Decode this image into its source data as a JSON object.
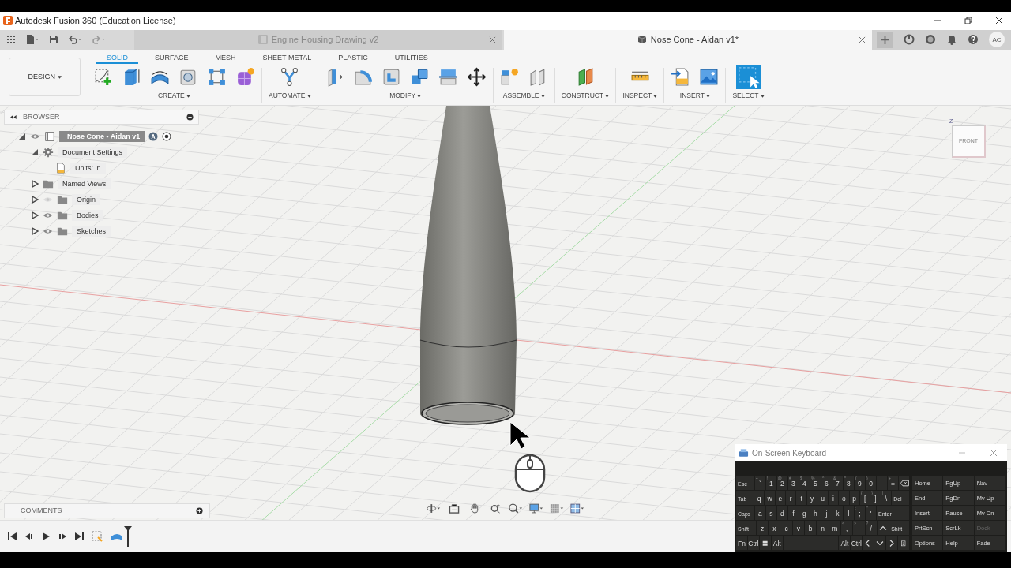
{
  "window": {
    "title": "Autodesk Fusion 360 (Education License)"
  },
  "document_tabs": [
    {
      "label": "Engine Housing Drawing v2",
      "selected": false
    },
    {
      "label": "Nose Cone - Aidan v1*",
      "selected": true
    }
  ],
  "user": {
    "initials": "AC"
  },
  "workspace": {
    "label": "DESIGN"
  },
  "toolbar_tabs": [
    {
      "label": "SOLID",
      "selected": true
    },
    {
      "label": "SURFACE",
      "selected": false
    },
    {
      "label": "MESH",
      "selected": false
    },
    {
      "label": "SHEET METAL",
      "selected": false
    },
    {
      "label": "PLASTIC",
      "selected": false
    },
    {
      "label": "UTILITIES",
      "selected": false
    }
  ],
  "tool_groups": [
    {
      "label": "CREATE"
    },
    {
      "label": "AUTOMATE"
    },
    {
      "label": "MODIFY"
    },
    {
      "label": "ASSEMBLE"
    },
    {
      "label": "CONSTRUCT"
    },
    {
      "label": "INSPECT"
    },
    {
      "label": "INSERT"
    },
    {
      "label": "SELECT"
    }
  ],
  "browser": {
    "title": "BROWSER",
    "tree": [
      {
        "label": "Nose Cone - Aidan v1",
        "kind": "component",
        "expanded": true,
        "visible": true,
        "selected": true,
        "children": [
          {
            "label": "Document Settings",
            "kind": "settings",
            "expanded": true,
            "selected": false,
            "children": [
              {
                "label": "Units: in",
                "kind": "units",
                "selected": false
              }
            ]
          },
          {
            "label": "Named Views",
            "kind": "folder",
            "expanded": false,
            "selected": false
          },
          {
            "label": "Origin",
            "kind": "folder",
            "expanded": false,
            "visible": false,
            "selected": false
          },
          {
            "label": "Bodies",
            "kind": "folder",
            "expanded": false,
            "visible": true,
            "selected": false
          },
          {
            "label": "Sketches",
            "kind": "folder",
            "expanded": false,
            "visible": true,
            "selected": false
          }
        ]
      }
    ]
  },
  "view_cube": {
    "face": "FRONT",
    "axis": "Z"
  },
  "comments": {
    "title": "COMMENTS"
  },
  "on_screen_keyboard": {
    "title": "On-Screen Keyboard",
    "main_rows": [
      [
        {
          "label": "Esc",
          "kind": "mod"
        },
        {
          "label": "`",
          "upper": "~",
          "kind": "char"
        },
        {
          "label": "1",
          "upper": "!",
          "kind": "char"
        },
        {
          "label": "2",
          "upper": "@",
          "kind": "char"
        },
        {
          "label": "3",
          "upper": "#",
          "kind": "char"
        },
        {
          "label": "4",
          "upper": "$",
          "kind": "char"
        },
        {
          "label": "5",
          "upper": "%",
          "kind": "char"
        },
        {
          "label": "6",
          "upper": "^",
          "kind": "char"
        },
        {
          "label": "7",
          "upper": "&",
          "kind": "char"
        },
        {
          "label": "8",
          "upper": "*",
          "kind": "char"
        },
        {
          "label": "9",
          "upper": "(",
          "kind": "char"
        },
        {
          "label": "0",
          "upper": ")",
          "kind": "char"
        },
        {
          "label": "-",
          "upper": "_",
          "kind": "char"
        },
        {
          "label": "=",
          "upper": "+",
          "kind": "char"
        },
        {
          "kind": "backspace"
        }
      ],
      [
        {
          "label": "Tab",
          "kind": "mod"
        },
        {
          "label": "q",
          "kind": "char"
        },
        {
          "label": "w",
          "kind": "char"
        },
        {
          "label": "e",
          "kind": "char"
        },
        {
          "label": "r",
          "kind": "char"
        },
        {
          "label": "t",
          "kind": "char"
        },
        {
          "label": "y",
          "kind": "char"
        },
        {
          "label": "u",
          "kind": "char"
        },
        {
          "label": "i",
          "kind": "char"
        },
        {
          "label": "o",
          "kind": "char"
        },
        {
          "label": "p",
          "kind": "char"
        },
        {
          "label": "[",
          "upper": "{",
          "kind": "char"
        },
        {
          "label": "]",
          "upper": "}",
          "kind": "char"
        },
        {
          "label": "\\",
          "upper": "|",
          "kind": "char"
        },
        {
          "label": "Del",
          "kind": "mod"
        }
      ],
      [
        {
          "label": "Caps",
          "kind": "mod"
        },
        {
          "label": "a",
          "kind": "char"
        },
        {
          "label": "s",
          "kind": "char"
        },
        {
          "label": "d",
          "kind": "char"
        },
        {
          "label": "f",
          "kind": "char"
        },
        {
          "label": "g",
          "kind": "char"
        },
        {
          "label": "h",
          "kind": "char"
        },
        {
          "label": "j",
          "kind": "char"
        },
        {
          "label": "k",
          "kind": "char"
        },
        {
          "label": "l",
          "kind": "char"
        },
        {
          "label": ";",
          "upper": ":",
          "kind": "char"
        },
        {
          "label": "'",
          "upper": "\"",
          "kind": "char"
        },
        {
          "label": "Enter",
          "kind": "wide"
        }
      ],
      [
        {
          "label": "Shift",
          "kind": "mod"
        },
        {
          "label": "z",
          "kind": "char"
        },
        {
          "label": "x",
          "kind": "char"
        },
        {
          "label": "c",
          "kind": "char"
        },
        {
          "label": "v",
          "kind": "char"
        },
        {
          "label": "b",
          "kind": "char"
        },
        {
          "label": "n",
          "kind": "char"
        },
        {
          "label": "m",
          "kind": "char"
        },
        {
          "label": ",",
          "upper": "<",
          "kind": "char"
        },
        {
          "label": ".",
          "upper": ">",
          "kind": "char"
        },
        {
          "label": "/",
          "upper": "?",
          "kind": "char"
        },
        {
          "kind": "up"
        },
        {
          "label": "Shift",
          "kind": "mod"
        }
      ],
      [
        {
          "label": "Fn",
          "kind": "char"
        },
        {
          "label": "Ctrl",
          "kind": "char"
        },
        {
          "kind": "win"
        },
        {
          "label": "Alt",
          "kind": "char"
        },
        {
          "kind": "space"
        },
        {
          "label": "Alt",
          "kind": "char"
        },
        {
          "label": "Ctrl",
          "kind": "char"
        },
        {
          "kind": "left"
        },
        {
          "kind": "down"
        },
        {
          "kind": "right"
        },
        {
          "kind": "menu"
        }
      ]
    ],
    "side_rows": [
      [
        {
          "label": "Home",
          "disabled": false
        },
        {
          "label": "PgUp",
          "disabled": false
        },
        {
          "label": "Nav",
          "disabled": false
        }
      ],
      [
        {
          "label": "End",
          "disabled": false
        },
        {
          "label": "PgDn",
          "disabled": false
        },
        {
          "label": "Mv Up",
          "disabled": false
        }
      ],
      [
        {
          "label": "Insert",
          "disabled": false
        },
        {
          "label": "Pause",
          "disabled": false
        },
        {
          "label": "Mv Dn",
          "disabled": false
        }
      ],
      [
        {
          "label": "PrtScn",
          "disabled": false
        },
        {
          "label": "ScrLk",
          "disabled": false
        },
        {
          "label": "Dock",
          "disabled": true
        }
      ],
      [
        {
          "label": "Options",
          "disabled": false
        },
        {
          "label": "Help",
          "disabled": false
        },
        {
          "label": "Fade",
          "disabled": false
        }
      ]
    ]
  }
}
